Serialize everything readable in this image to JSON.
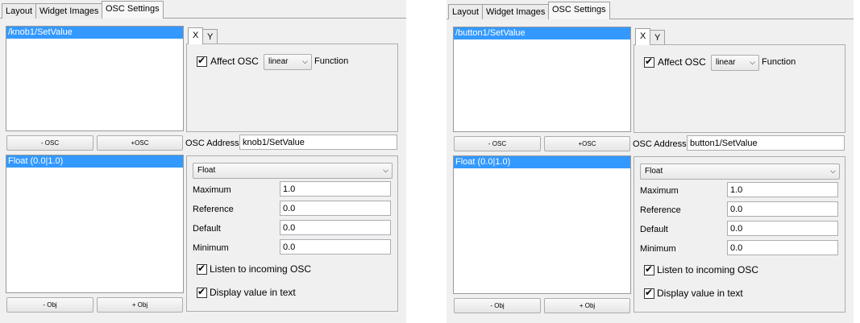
{
  "tabs": [
    "Layout",
    "Widget Images",
    "OSC Settings"
  ],
  "left": {
    "osc_list": [
      "/knob1/SetValue"
    ],
    "minus_osc": "- OSC",
    "plus_osc": "+OSC",
    "xy_tabs": [
      "X",
      "Y"
    ],
    "affect_osc": "Affect OSC",
    "function_value": "linear",
    "function_label": "Function",
    "osc_address_label": "OSC Address",
    "osc_address": "knob1/SetValue",
    "obj_list": [
      "Float (0.0|1.0)"
    ],
    "minus_obj": "- Obj",
    "plus_obj": "+ Obj",
    "type_value": "Float",
    "maximum_label": "Maximum",
    "maximum": "1.0",
    "reference_label": "Reference",
    "reference": "0.0",
    "default_label": "Default",
    "default": "0.0",
    "minimum_label": "Minimum",
    "minimum": "0.0",
    "listen_label": "Listen to incoming OSC",
    "display_label": "Display value in text"
  },
  "right": {
    "osc_list": [
      "/button1/SetValue"
    ],
    "minus_osc": "- OSC",
    "plus_osc": "+OSC",
    "xy_tabs": [
      "X",
      "Y"
    ],
    "affect_osc": "Affect OSC",
    "function_value": "linear",
    "function_label": "Function",
    "osc_address_label": "OSC Address",
    "osc_address": "button1/SetValue",
    "obj_list": [
      "Float (0.0|1.0)"
    ],
    "minus_obj": "- Obj",
    "plus_obj": "+ Obj",
    "type_value": "Float",
    "maximum_label": "Maximum",
    "maximum": "1.0",
    "reference_label": "Reference",
    "reference": "0.0",
    "default_label": "Default",
    "default": "0.0",
    "minimum_label": "Minimum",
    "minimum": "0.0",
    "listen_label": "Listen to incoming OSC",
    "display_label": "Display value in text"
  },
  "colors": {
    "selection": "#3399ff",
    "panel": "#f0f0f0"
  }
}
